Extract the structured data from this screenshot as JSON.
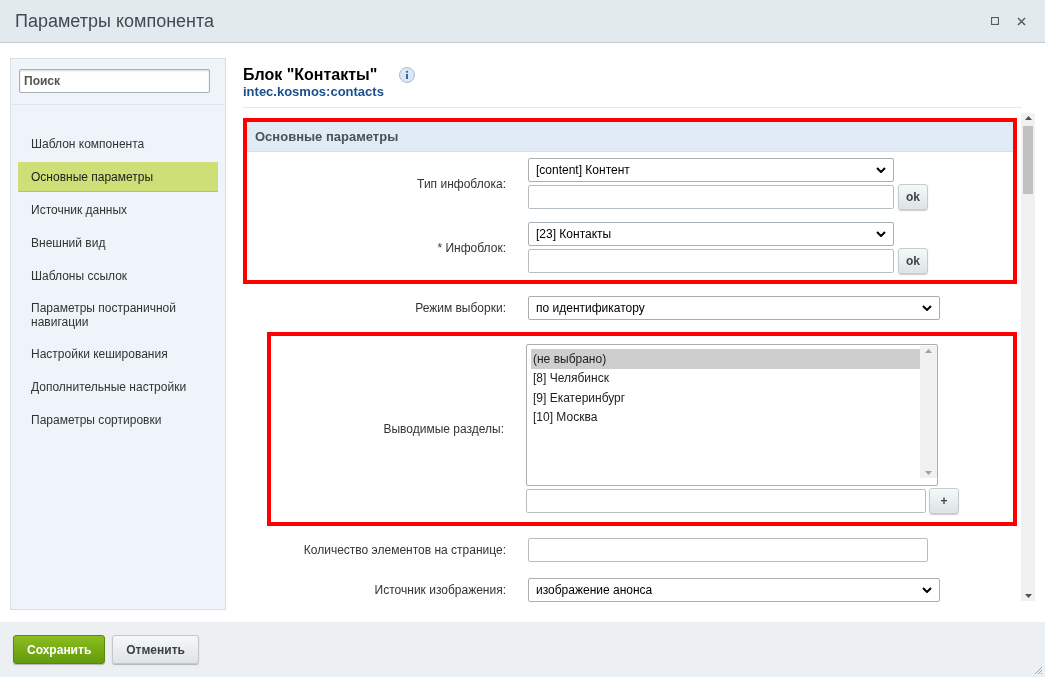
{
  "window": {
    "title": "Параметры компонента"
  },
  "sidebar": {
    "search": {
      "placeholder": "Поиск"
    },
    "items": [
      {
        "label": "Шаблон компонента",
        "selected": false
      },
      {
        "label": "Основные параметры",
        "selected": true
      },
      {
        "label": "Источник данных",
        "selected": false
      },
      {
        "label": "Внешний вид",
        "selected": false
      },
      {
        "label": "Шаблоны ссылок",
        "selected": false
      },
      {
        "label": "Параметры постраничной навигации",
        "selected": false
      },
      {
        "label": "Настройки кеширования",
        "selected": false
      },
      {
        "label": "Дополнительные настройки",
        "selected": false
      },
      {
        "label": "Параметры сортировки",
        "selected": false
      }
    ]
  },
  "header": {
    "title": "Блок \"Контакты\"",
    "code": "intec.kosmos:contacts"
  },
  "groups": [
    {
      "highlighted": true,
      "heading": "Основные параметры",
      "fields": [
        {
          "kind": "select_search",
          "label": "Тип инфоблока:",
          "value": "[content] Контент",
          "button": "ok"
        },
        {
          "kind": "select_search",
          "label": "* Инфоблок:",
          "value": "[23] Контакты",
          "button": "ok"
        }
      ]
    },
    {
      "highlighted": false,
      "fields": [
        {
          "kind": "select",
          "label": "Режим выборки:",
          "value": "по идентификатору"
        }
      ]
    },
    {
      "highlighted": true,
      "fields": [
        {
          "kind": "multiselect",
          "label": "Выводимые разделы:",
          "options": [
            {
              "label": "(не выбрано)",
              "selected": true
            },
            {
              "label": "[8] Челябинск",
              "selected": false
            },
            {
              "label": "[9] Екатеринбург",
              "selected": false
            },
            {
              "label": "[10] Москва",
              "selected": false
            }
          ],
          "button": "+"
        }
      ]
    },
    {
      "highlighted": false,
      "fields": [
        {
          "kind": "text",
          "label": "Количество элементов на странице:"
        },
        {
          "kind": "select",
          "label": "Источник изображения:",
          "value": "изображение анонса"
        }
      ]
    }
  ],
  "buttons": [
    {
      "label": "Сохранить",
      "kind": "primary"
    },
    {
      "label": "Отменить",
      "kind": "secondary"
    }
  ]
}
